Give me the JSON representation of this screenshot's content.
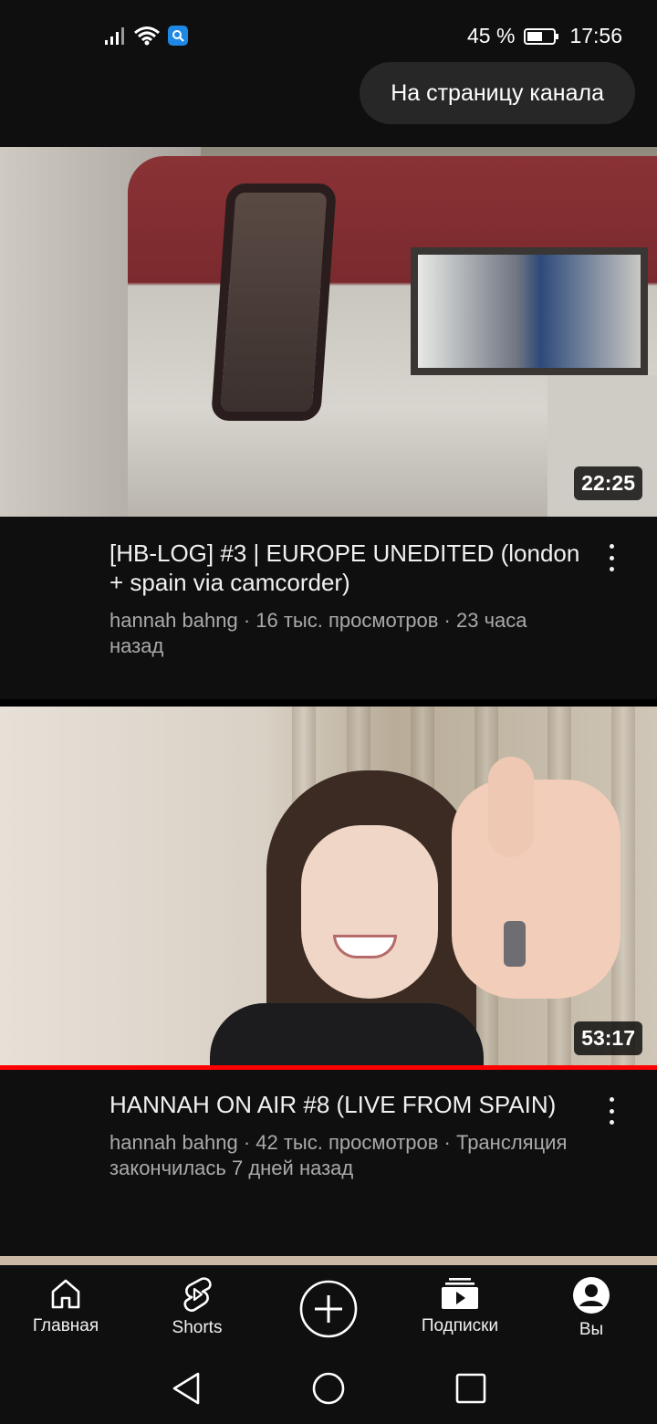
{
  "status": {
    "battery_text": "45 %",
    "time": "17:56"
  },
  "header": {
    "channel_button_label": "На страницу канала"
  },
  "videos": [
    {
      "title": "[HB-LOG] #3 | EUROPE UNEDITED (london + spain via camcorder)",
      "meta": "hannah bahng · 16 тыс. просмотров · 23 часа назад",
      "duration": "22:25"
    },
    {
      "title": "HANNAH ON AIR #8 (LIVE FROM SPAIN)",
      "meta": "hannah bahng · 42 тыс. просмотров · Трансляция закончилась 7 дней назад",
      "duration": "53:17",
      "watched_fraction": 1.0
    }
  ],
  "bottom_nav": {
    "items": [
      {
        "label": "Главная",
        "icon": "home-icon"
      },
      {
        "label": "Shorts",
        "icon": "shorts-icon"
      },
      {
        "label": "",
        "icon": "create-icon"
      },
      {
        "label": "Подписки",
        "icon": "subscriptions-icon"
      },
      {
        "label": "Вы",
        "icon": "account-icon"
      }
    ]
  },
  "colors": {
    "background": "#0f0f0f",
    "progress": "#ff0000",
    "meta_text": "#aaaaaa"
  }
}
